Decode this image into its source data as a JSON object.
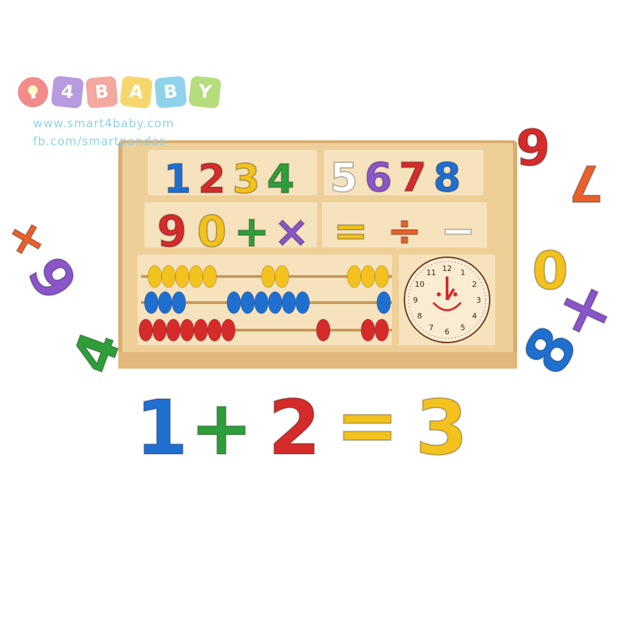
{
  "brand": {
    "tiles": [
      {
        "char": "",
        "color": "#f28b8b",
        "icon": "lightbulb-icon"
      },
      {
        "char": "4",
        "color": "#b79be0"
      },
      {
        "char": "B",
        "color": "#f3a8a0"
      },
      {
        "char": "A",
        "color": "#f5d76e"
      },
      {
        "char": "B",
        "color": "#8fd3ea"
      },
      {
        "char": "Y",
        "color": "#b6dc7e"
      }
    ],
    "website": "www.smart4baby.com",
    "facebook": "fb.com/smartpandas"
  },
  "equation": {
    "a": "1",
    "plus": "+",
    "b": "2",
    "equals": "=",
    "result": "3"
  },
  "tray": {
    "top_left_numbers": [
      "1",
      "2",
      "3",
      "4"
    ],
    "top_right_numbers": [
      "5",
      "6",
      "7",
      "8"
    ],
    "middle_left": [
      "9",
      "0",
      "+",
      "×"
    ],
    "middle_right": [
      "=",
      "÷",
      "−"
    ],
    "clock_numbers": [
      "12",
      "1",
      "2",
      "3",
      "4",
      "5",
      "6",
      "7",
      "8",
      "9",
      "10",
      "11"
    ]
  },
  "loose_pieces": [
    "9",
    "7",
    "0",
    "×",
    "8",
    "+",
    "6",
    "4"
  ],
  "colors": {
    "wood": "#e9c48a",
    "wood_dark": "#c99a5b",
    "red": "#d52b2b",
    "blue": "#1f6fd1",
    "yellow": "#f3c21e",
    "green": "#2f9e3a",
    "purple": "#8a55c9",
    "orange": "#e8612c"
  }
}
